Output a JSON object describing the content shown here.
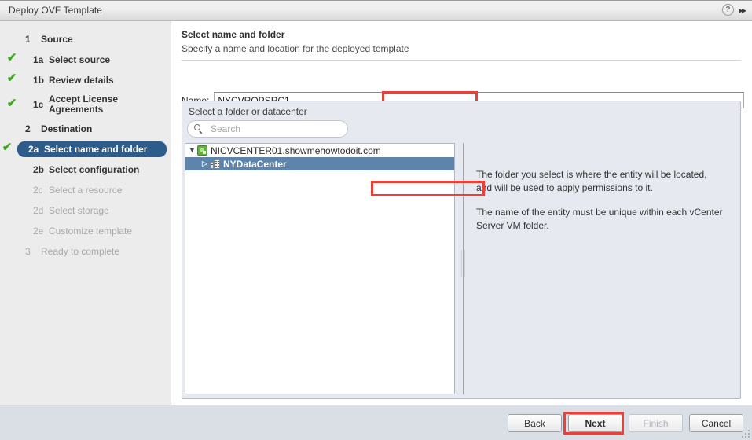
{
  "window": {
    "title": "Deploy OVF Template",
    "help_icon": "help-icon",
    "collapse_icon": "double-chevron-right-icon"
  },
  "sidebar": {
    "items": [
      {
        "num": "1",
        "label": "Source",
        "level": 1,
        "state": "header",
        "check": false
      },
      {
        "num": "1a",
        "label": "Select source",
        "level": 2,
        "state": "done",
        "check": true
      },
      {
        "num": "1b",
        "label": "Review details",
        "level": 2,
        "state": "done",
        "check": true
      },
      {
        "num": "1c",
        "label": "Accept License Agreements",
        "level": 2,
        "state": "done",
        "check": true
      },
      {
        "num": "2",
        "label": "Destination",
        "level": 1,
        "state": "header",
        "check": false
      },
      {
        "num": "2a",
        "label": "Select name and folder",
        "level": 2,
        "state": "selected",
        "check": true
      },
      {
        "num": "2b",
        "label": "Select configuration",
        "level": 2,
        "state": "active",
        "check": false
      },
      {
        "num": "2c",
        "label": "Select a resource",
        "level": 2,
        "state": "disabled",
        "check": false
      },
      {
        "num": "2d",
        "label": "Select storage",
        "level": 2,
        "state": "disabled",
        "check": false
      },
      {
        "num": "2e",
        "label": "Customize template",
        "level": 2,
        "state": "disabled",
        "check": false
      },
      {
        "num": "3",
        "label": "Ready to complete",
        "level": 1,
        "state": "disabled",
        "check": false
      }
    ],
    "check_glyph": "✔"
  },
  "main": {
    "title": "Select name and folder",
    "subtitle": "Specify a name and location for the deployed template",
    "name_label": "Name:",
    "name_value": "NYCVROPSRC1",
    "name_placeholder": "",
    "picker_legend": "Select a folder or datacenter",
    "search": {
      "placeholder": "Search",
      "value": "",
      "icon": "search-icon"
    },
    "tree": [
      {
        "label": "NICVCENTER01.showmehowtodoit.com",
        "icon": "vcenter-icon",
        "twisty": "▼",
        "expanded": true,
        "selected": false,
        "level": 0
      },
      {
        "label": "NYDataCenter",
        "icon": "datacenter-icon",
        "twisty": "▷",
        "expanded": false,
        "selected": true,
        "level": 1
      }
    ],
    "description": [
      "The folder you select is where the entity will be located, and will be used to apply permissions to it.",
      "The name of the entity must be unique within each vCenter Server VM folder."
    ]
  },
  "footer": {
    "buttons": [
      {
        "label": "Back",
        "state": "enabled"
      },
      {
        "label": "Next",
        "state": "primary"
      },
      {
        "label": "Finish",
        "state": "disabled"
      },
      {
        "label": "Cancel",
        "state": "enabled"
      }
    ]
  },
  "annotations": {
    "color": "#e8413a",
    "targets": [
      "name-value",
      "nydatacenter-tree-item",
      "next-button"
    ]
  }
}
